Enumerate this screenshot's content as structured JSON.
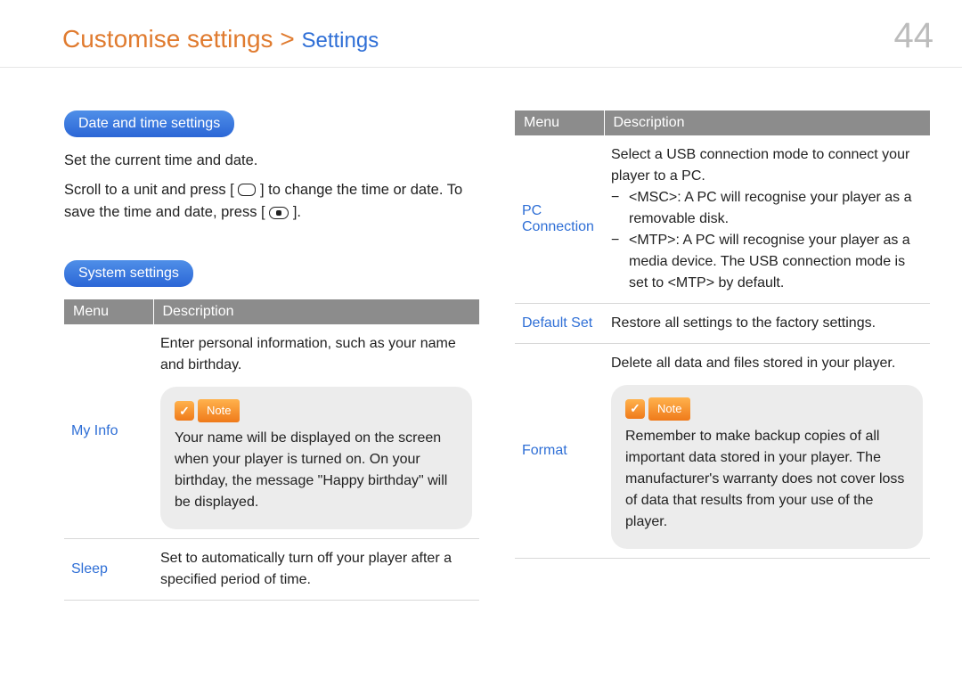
{
  "header": {
    "breadcrumb_main": "Customise settings",
    "breadcrumb_sep": ">",
    "breadcrumb_sub": "Settings",
    "page_number": "44"
  },
  "left": {
    "section1_title": "Date and time settings",
    "section1_line1": "Set the current time and date.",
    "section1_line2a": "Scroll to a unit and press [",
    "section1_line2b": "] to change the time or date. To save the time and date, press [",
    "section1_line2c": "].",
    "section2_title": "System settings",
    "table": {
      "th_menu": "Menu",
      "th_desc": "Description",
      "rows": [
        {
          "menu": "My Info",
          "desc_top": "Enter personal information, such as your name and birthday.",
          "note_label": "Note",
          "note_body": "Your name will be displayed on the screen when your player is turned on. On your birthday, the message \"Happy birthday\" will be displayed."
        },
        {
          "menu": "Sleep",
          "desc_top": "Set to automatically turn off your player after a specified period of time."
        }
      ]
    }
  },
  "right": {
    "table": {
      "th_menu": "Menu",
      "th_desc": "Description",
      "rows": [
        {
          "menu": "PC Connection",
          "desc_top": "Select a USB connection mode to connect your player to a PC.",
          "bullets": [
            "<MSC>: A PC will recognise your player as a removable disk.",
            "<MTP>: A PC will recognise your player as a media device. The USB connection mode is set to <MTP> by default."
          ]
        },
        {
          "menu": "Default Set",
          "desc_top": "Restore all settings to the factory settings."
        },
        {
          "menu": "Format",
          "desc_top": "Delete all data and files stored in your player.",
          "note_label": "Note",
          "note_body": "Remember to make backup copies of all important data stored in your player. The manufacturer's warranty does not cover loss of data that results from your use of the player."
        }
      ]
    }
  }
}
